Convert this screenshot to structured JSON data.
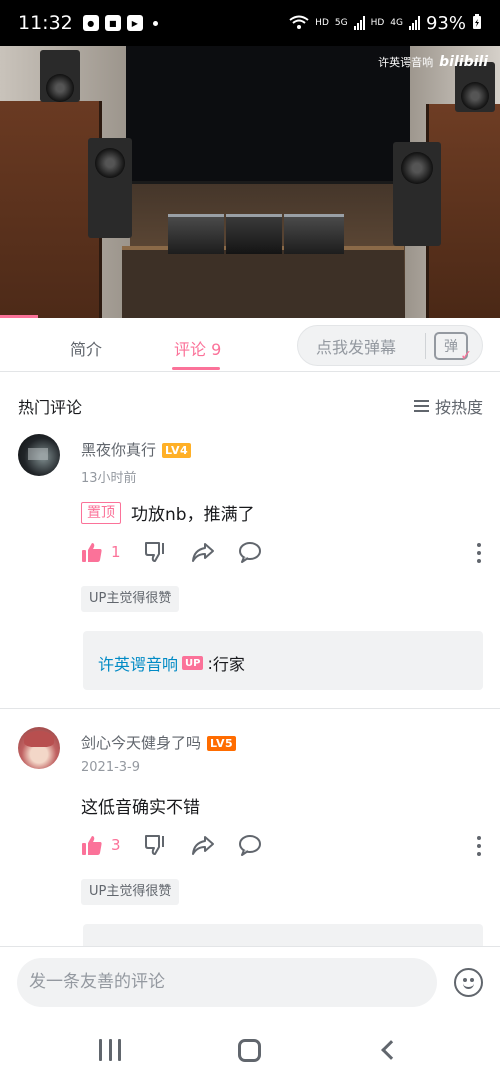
{
  "status_bar": {
    "time": "11:32",
    "battery": "93%",
    "net_hd1": "HD",
    "net_5g": "5G",
    "net_hd2": "HD",
    "net_4g": "4G"
  },
  "video": {
    "watermark_author": "许英谔音响",
    "watermark_logo": "bilibili"
  },
  "tabs": [
    {
      "label": "简介",
      "active": false
    },
    {
      "label": "评论 9",
      "active": true
    }
  ],
  "danmaku": {
    "placeholder": "点我发弹幕",
    "button_label": "弹"
  },
  "comments_header": {
    "title": "热门评论",
    "sort_label": "按热度"
  },
  "comments": [
    {
      "username": "黑夜你真行",
      "level": "LV4",
      "time": "13小时前",
      "pinned_label": "置顶",
      "text": "功放nb，推满了",
      "like_count": "1",
      "up_tag": "UP主觉得很赞",
      "reply": {
        "author": "许英谔音响",
        "badge": "UP",
        "separator": ":",
        "text": "行家"
      }
    },
    {
      "username": "剑心今天健身了吗",
      "level": "LV5",
      "time": "2021-3-9",
      "text": "这低音确实不错",
      "like_count": "3",
      "up_tag": "UP主觉得很赞"
    }
  ],
  "bottom_input": {
    "placeholder": "发一条友善的评论"
  },
  "colors": {
    "accent": "#fb7299",
    "link": "#008ac5",
    "lv4": "#ffb027",
    "lv5": "#ff6c00"
  }
}
